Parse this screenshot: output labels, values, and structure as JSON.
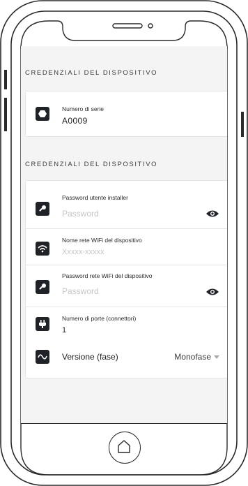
{
  "colors": {
    "screen_bg": "#f4f4f5",
    "card_bg": "#ffffff",
    "icon_bg": "#1f2227",
    "placeholder": "#c6c6c9",
    "frame": "#2a2a2a"
  },
  "section_device": {
    "title": "Credenziali del dispositivo",
    "serial": {
      "icon": "hexagon-icon",
      "label": "Numero di serie",
      "value": "A0009"
    }
  },
  "section_credentials": {
    "title": "Credenziali del dispositivo",
    "installer_password": {
      "icon": "key-icon",
      "label": "Password utente installer",
      "placeholder": "Password"
    },
    "wifi_name": {
      "icon": "wifi-icon",
      "label": "Nome rete WiFi del dispositivo",
      "placeholder": "Xxxxx-xxxxx"
    },
    "wifi_password": {
      "icon": "key-icon",
      "label": "Password rete WiFi del dispositivo",
      "placeholder": "Password"
    },
    "ports": {
      "icon": "plug-icon",
      "label": "Numero di porte (connettori)",
      "value": "1"
    },
    "version": {
      "icon": "sine-wave-icon",
      "label": "Versione (fase)",
      "selected": "Monofase"
    }
  }
}
